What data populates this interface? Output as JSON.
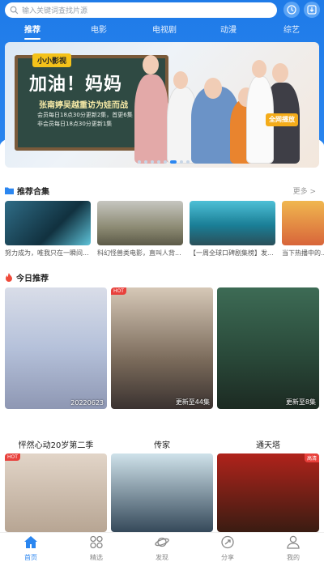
{
  "search": {
    "placeholder": "输入关键词查找片源"
  },
  "top_icons": [
    "clock-icon",
    "download-icon"
  ],
  "tabs": [
    {
      "label": "推荐",
      "active": true
    },
    {
      "label": "电影",
      "active": false
    },
    {
      "label": "电视剧",
      "active": false
    },
    {
      "label": "动漫",
      "active": false
    },
    {
      "label": "综艺",
      "active": false
    }
  ],
  "banner": {
    "tag": "小小影视",
    "title": "加油！妈妈",
    "subtitle": "张南婷吴越重访为娃而战",
    "line1": "会员每日18点30分更新2集，首更6集",
    "line2": "非会员每日18点30分更新1集",
    "badge": "全网播放",
    "slide_count": 8,
    "active_slide": 6
  },
  "collections_section": {
    "title": "推荐合集",
    "more": "更多 >",
    "items": [
      {
        "caption": "努力成为，唯我只在一瞬间..."
      },
      {
        "caption": "科幻怪兽类电影，直叫人背..."
      },
      {
        "caption": "【一周全球口碑剧集榜】发..."
      },
      {
        "caption": "当下热播中的..."
      }
    ]
  },
  "today_section": {
    "title": "今日推荐",
    "cards": [
      {
        "title": "怦然心动20岁第二季",
        "ep": "20220623",
        "hot": false
      },
      {
        "title": "传家",
        "ep": "更新至44集",
        "hot": true
      },
      {
        "title": "通天塔",
        "ep": "更新至8集",
        "hot": false
      },
      {
        "title": "",
        "ep": "",
        "hot": true
      },
      {
        "title": "",
        "ep": "",
        "hot": false
      },
      {
        "title": "",
        "ep": "",
        "hot": false,
        "badge": "高清"
      }
    ]
  },
  "nav": [
    {
      "label": "首页",
      "icon": "home-icon",
      "active": true
    },
    {
      "label": "精选",
      "icon": "grid-icon",
      "active": false
    },
    {
      "label": "发现",
      "icon": "planet-icon",
      "active": false
    },
    {
      "label": "分享",
      "icon": "share-icon",
      "active": false
    },
    {
      "label": "我的",
      "icon": "user-icon",
      "active": false
    }
  ],
  "colors": {
    "accent": "#2b86f0",
    "hot": "#e8413c"
  }
}
